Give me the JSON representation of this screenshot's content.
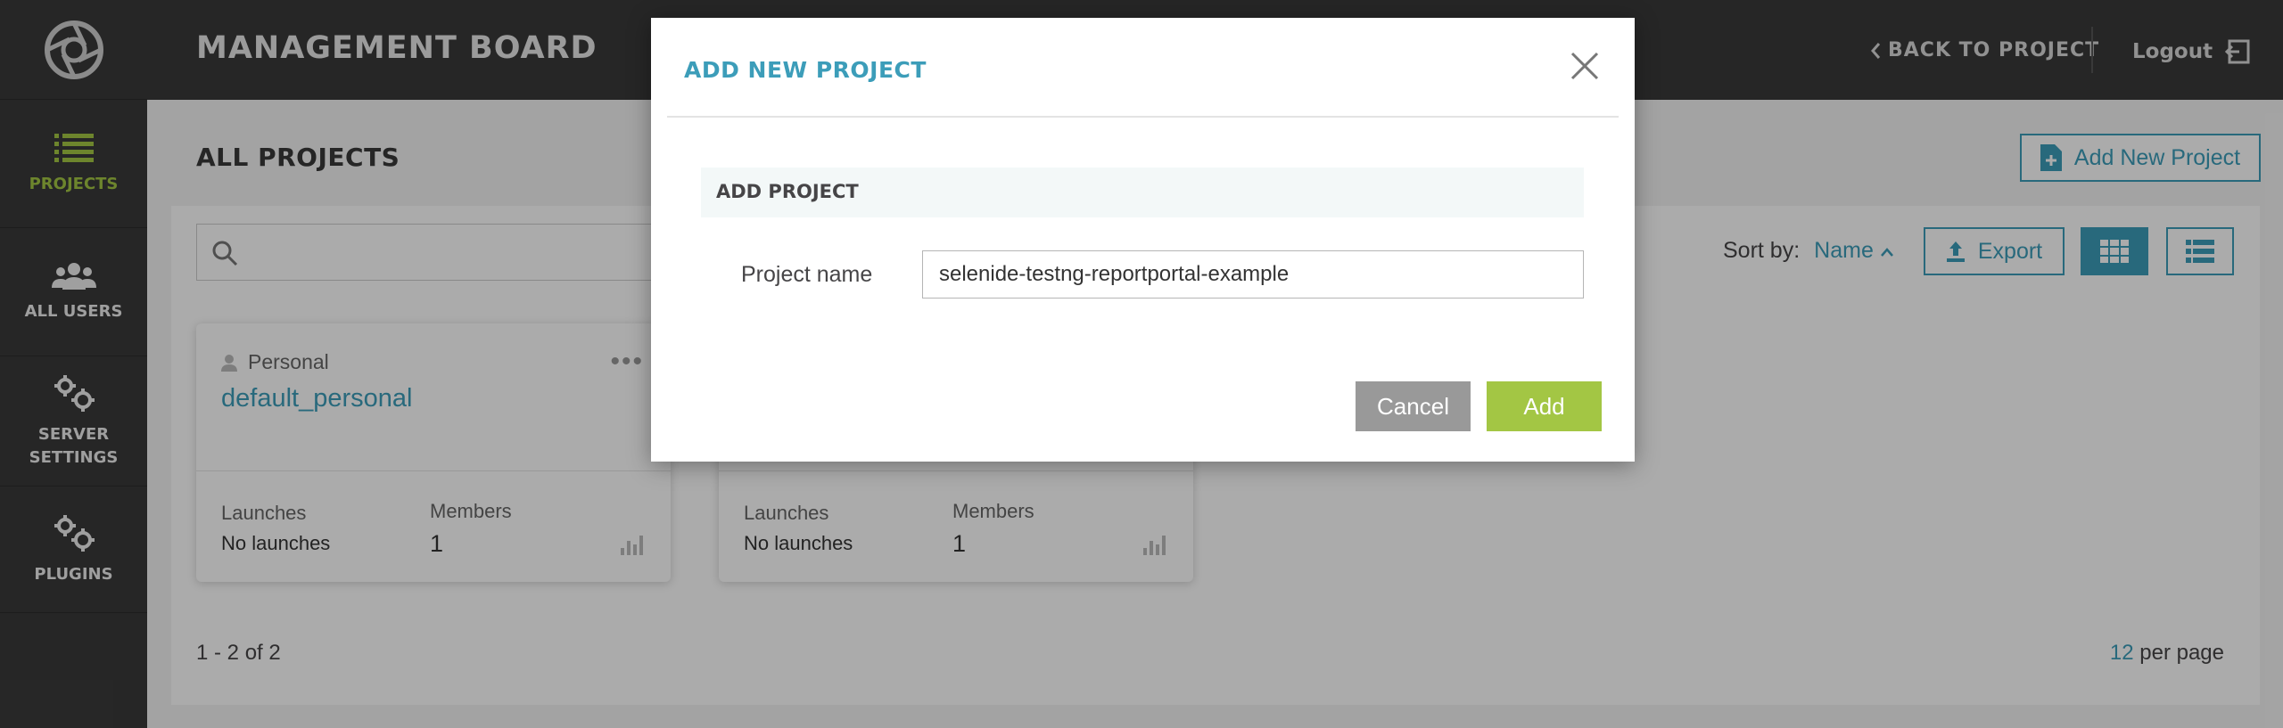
{
  "header": {
    "title": "MANAGEMENT BOARD",
    "back_label": "BACK TO PROJECT",
    "logout_label": "Logout"
  },
  "sidebar": {
    "items": [
      {
        "label": "PROJECTS",
        "icon": "list-icon",
        "active": true
      },
      {
        "label": "ALL USERS",
        "icon": "users-icon"
      },
      {
        "label_line1": "SERVER",
        "label_line2": "SETTINGS",
        "icon": "gears-icon"
      },
      {
        "label": "PLUGINS",
        "icon": "gears-icon"
      }
    ]
  },
  "content": {
    "page_title": "ALL PROJECTS",
    "add_project_label": "Add New Project",
    "sort_label": "Sort by:",
    "sort_value": "Name",
    "export_label": "Export",
    "pagination": "1 - 2 of 2",
    "per_page_count": "12",
    "per_page_label": "per page"
  },
  "cards": [
    {
      "type": "Personal",
      "name": "default_personal",
      "launches_label": "Launches",
      "launches_value": "No launches",
      "members_label": "Members",
      "members_value": "1"
    },
    {
      "launches_label": "Launches",
      "launches_value": "No launches",
      "members_label": "Members",
      "members_value": "1"
    }
  ],
  "modal": {
    "title": "ADD NEW PROJECT",
    "section": "ADD PROJECT",
    "field_label": "Project name",
    "field_value": "selenide-testng-reportportal-example",
    "cancel_label": "Cancel",
    "add_label": "Add"
  },
  "colors": {
    "accent": "#3c9db9",
    "active": "#a3c644",
    "sidebar_bg": "#3a3a3a"
  }
}
